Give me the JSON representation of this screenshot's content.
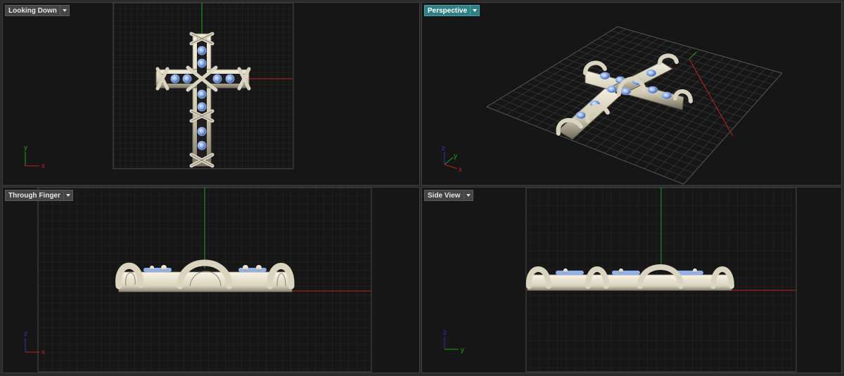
{
  "viewports": {
    "top_left": {
      "title": "Looking Down",
      "axis_a": "y",
      "axis_b": "x"
    },
    "top_right": {
      "title": "Perspective",
      "axis_a": "z",
      "axis_b": "y",
      "axis_c": "x"
    },
    "bottom_left": {
      "title": "Through Finger",
      "axis_a": "z",
      "axis_b": "x"
    },
    "bottom_right": {
      "title": "Side View",
      "axis_a": "z",
      "axis_b": "y"
    }
  },
  "colors": {
    "background": "#161616",
    "grid": "#3a3a3a",
    "axis_x": "#c02020",
    "axis_y": "#20a020",
    "active_tab": "#2f7f85",
    "metal": "#d9d3bf",
    "gem": "#8fb0ea"
  },
  "icons": [
    "chevron-down-icon"
  ]
}
